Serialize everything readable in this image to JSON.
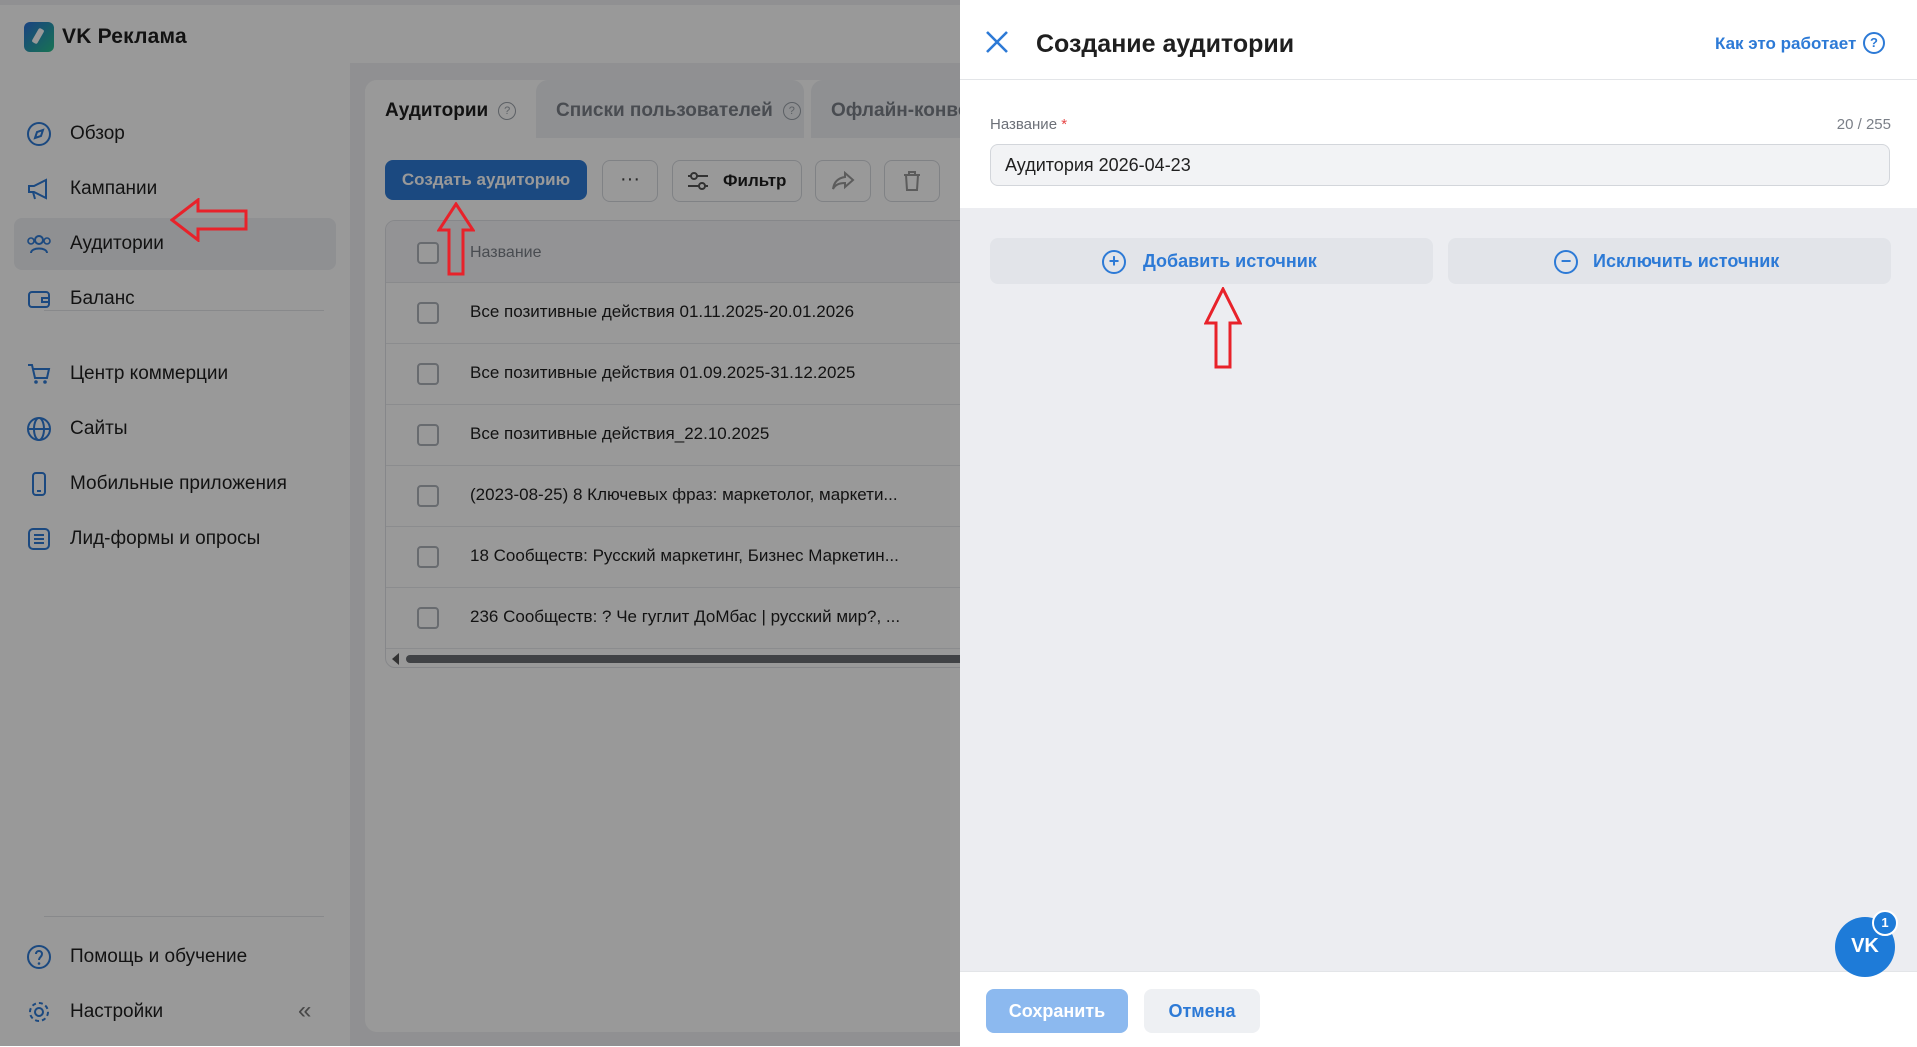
{
  "app": {
    "brand": "VK Реклама"
  },
  "sidebar": {
    "items": [
      {
        "label": "Обзор",
        "icon": "compass-icon"
      },
      {
        "label": "Кампании",
        "icon": "megaphone-icon"
      },
      {
        "label": "Аудитории",
        "icon": "users-icon",
        "active": true
      },
      {
        "label": "Баланс",
        "icon": "wallet-icon"
      },
      {
        "label": "Центр коммерции",
        "icon": "cart-icon"
      },
      {
        "label": "Сайты",
        "icon": "globe-icon"
      },
      {
        "label": "Мобильные приложения",
        "icon": "phone-icon"
      },
      {
        "label": "Лид-формы и опросы",
        "icon": "list-icon"
      }
    ],
    "bottom": [
      {
        "label": "Помощь и обучение",
        "icon": "help-icon"
      },
      {
        "label": "Настройки",
        "icon": "gear-icon"
      }
    ]
  },
  "main": {
    "tabs": [
      {
        "label": "Аудитории"
      },
      {
        "label": "Списки пользователей"
      },
      {
        "label": "Офлайн-конве"
      }
    ],
    "toolbar": {
      "create_label": "Создать аудиторию",
      "more_label": "···",
      "filter_label": "Фильтр"
    },
    "table": {
      "header": "Название",
      "rows": [
        "Все позитивные действия 01.11.2025-20.01.2026",
        "Все позитивные действия 01.09.2025-31.12.2025",
        "Все позитивные действия_22.10.2025",
        "(2023-08-25) 8 Ключевых фраз: маркетолог, маркети...",
        "18 Сообществ: Русский маркетинг, Бизнес Маркетин...",
        "236 Сообществ: ? Че гуглит ДоМбас | русский мир?, ..."
      ]
    }
  },
  "panel": {
    "title": "Создание аудитории",
    "help_link": "Как это работает",
    "name_label": "Название",
    "required_mark": "*",
    "counter": "20 / 255",
    "name_value": "Аудитория 2026-04-23",
    "add_source": "Добавить источник",
    "exclude_source": "Исключить источник",
    "save": "Сохранить",
    "cancel": "Отмена"
  },
  "chat": {
    "badge": "1",
    "logo": "VK"
  },
  "colors": {
    "accent": "#2d7ad6",
    "annotation_arrow": "#e8222a"
  }
}
